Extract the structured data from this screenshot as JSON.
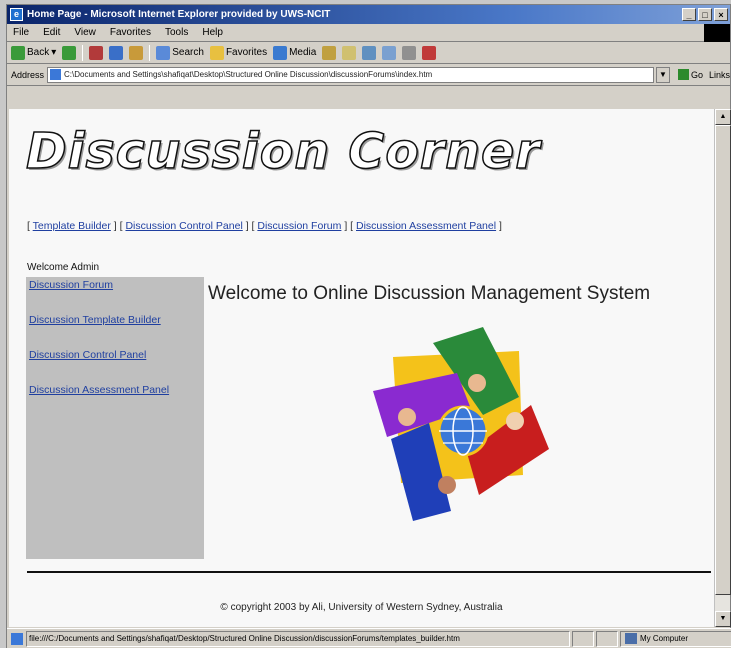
{
  "window": {
    "title": "Home Page - Microsoft Internet Explorer provided by UWS-NCIT",
    "controls": [
      "_",
      "□",
      "×"
    ]
  },
  "menubar": {
    "items": [
      "File",
      "Edit",
      "View",
      "Favorites",
      "Tools",
      "Help"
    ]
  },
  "toolbar": {
    "back": "Back",
    "search": "Search",
    "favorites": "Favorites",
    "media": "Media"
  },
  "addressbar": {
    "label": "Address",
    "url": "C:\\Documents and Settings\\shafiqat\\Desktop\\Structured Online Discussion\\discussionForums\\index.htm",
    "go": "Go",
    "links": "Links"
  },
  "page": {
    "logo_text": "Discussion Corner",
    "nav": [
      "Template Builder",
      "Discussion Control Panel",
      "Discussion Forum",
      "Discussion Assessment Panel"
    ],
    "welcome_user": "Welcome Admin",
    "sidebar": [
      "Discussion Forum",
      "Discussion Template Builder",
      "Discussion Control Panel",
      "Discussion Assessment Panel"
    ],
    "heading": "Welcome to Online Discussion Management System",
    "footer": "© copyright 2003 by Ali, University of Western Sydney, Australia"
  },
  "statusbar": {
    "text": "file:///C:/Documents and Settings/shafiqat/Desktop/Structured Online Discussion/discussionForums/templates_builder.htm",
    "zone": "My Computer"
  },
  "colors": {
    "link": "#1f3fa0",
    "sidebar_bg": "#bfbfbf",
    "titlebar": "#0a246a"
  }
}
